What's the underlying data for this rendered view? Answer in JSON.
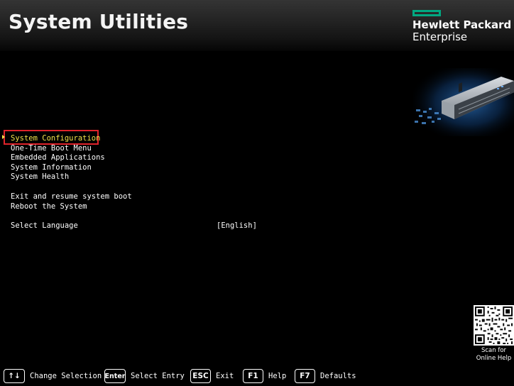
{
  "header": {
    "title": "System Utilities",
    "brand_line1": "Hewlett Packard",
    "brand_line2": "Enterprise",
    "brand_color": "#01a982"
  },
  "menu": {
    "selected_index": 0,
    "selected_color": "#f3e24a",
    "highlight_color": "#e0232b",
    "items": [
      {
        "label": "System Configuration"
      },
      {
        "label": "One-Time Boot Menu"
      },
      {
        "label": "Embedded Applications"
      },
      {
        "label": "System Information"
      },
      {
        "label": "System Health"
      },
      {
        "label": "Exit and resume system boot"
      },
      {
        "label": "Reboot the System"
      },
      {
        "label": "Select Language",
        "value": "[English]"
      }
    ]
  },
  "qr": {
    "caption_line1": "Scan for",
    "caption_line2": "Online Help"
  },
  "footer": {
    "hints": [
      {
        "key": "↑↓",
        "key_icon": "up-down-arrows-icon",
        "label": "Change Selection"
      },
      {
        "key": "Enter",
        "label": "Select Entry"
      },
      {
        "key": "ESC",
        "label": "Exit"
      },
      {
        "key": "F1",
        "label": "Help"
      },
      {
        "key": "F7",
        "label": "Defaults"
      }
    ]
  }
}
